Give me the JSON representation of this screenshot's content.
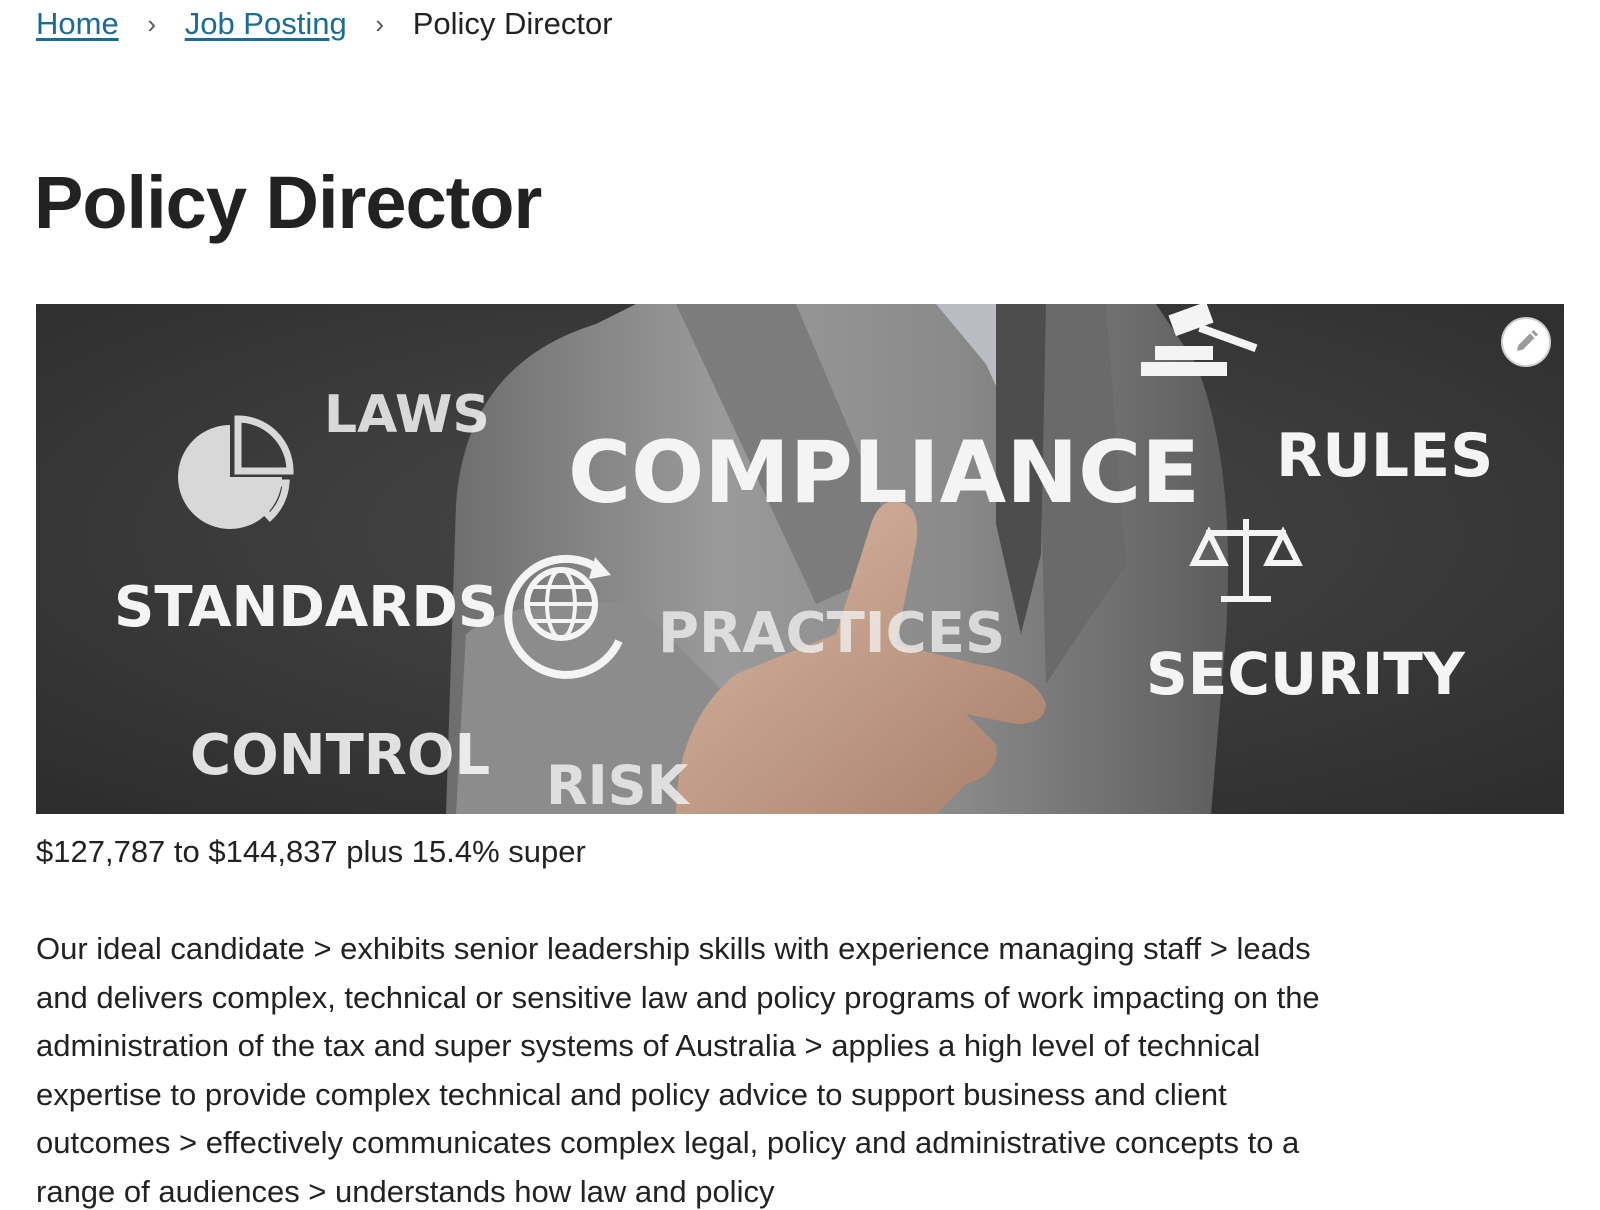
{
  "breadcrumb": {
    "home": "Home",
    "job_posting": "Job Posting",
    "current": "Policy Director",
    "separator": "›"
  },
  "page": {
    "title": "Policy Director"
  },
  "hero_image": {
    "words": {
      "laws": "LAWS",
      "compliance": "COMPLIANCE",
      "rules": "RULES",
      "standards": "STANDARDS",
      "practices": "PRACTICES",
      "security": "SECURITY",
      "control": "CONTROL",
      "risk": "RISK"
    },
    "icons": [
      "pie-chart-icon",
      "gavel-icon",
      "scales-icon",
      "globe-refresh-icon"
    ],
    "edit_icon": "pencil-icon"
  },
  "job": {
    "salary": "$127,787 to $144,837 plus 15.4% super",
    "description": "Our ideal candidate > exhibits senior leadership skills with experience managing staff > leads and delivers complex, technical or sensitive law and policy programs of work impacting on the administration of the tax and super systems of Australia > applies a high level of technical expertise to provide complex technical and policy advice to support business and client outcomes > effectively communicates complex legal, policy and administrative concepts to a range of audiences > understands how law and policy"
  },
  "colors": {
    "link": "#1a6c94",
    "text": "#222222",
    "hero_background": "#3b3b3b"
  }
}
